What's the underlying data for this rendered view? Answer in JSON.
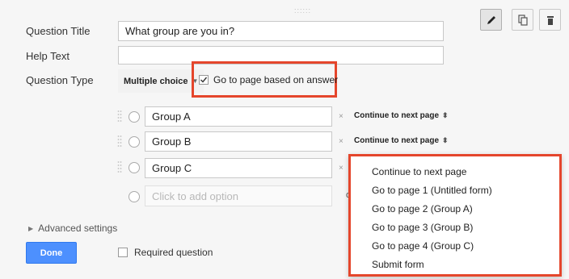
{
  "labels": {
    "question_title": "Question Title",
    "help_text": "Help Text",
    "question_type": "Question Type"
  },
  "fields": {
    "question_title_value": "What group are you in?",
    "help_text_value": ""
  },
  "question_type": {
    "selected": "Multiple choice",
    "go_to_page_label": "Go to page based on answer",
    "go_to_page_checked": true
  },
  "options": [
    {
      "label": "Group A",
      "action": "Continue to next page"
    },
    {
      "label": "Group B",
      "action": "Continue to next page"
    },
    {
      "label": "Group C",
      "action": ""
    }
  ],
  "add_option_placeholder": "Click to add option",
  "add_option_cutoff_text": "o",
  "remove_glyph": "×",
  "toolbar_icons": [
    "pencil-icon",
    "duplicate-icon",
    "trash-icon"
  ],
  "page_menu": [
    "Continue to next page",
    "Go to page 1 (Untitled form)",
    "Go to page 2 (Group A)",
    "Go to page 3 (Group B)",
    "Go to page 4 (Group C)",
    "Submit form"
  ],
  "advanced_settings": "Advanced settings",
  "done_button": "Done",
  "required_question": "Required question",
  "colors": {
    "highlight": "#e5462c",
    "done_button": "#4d90fe"
  }
}
